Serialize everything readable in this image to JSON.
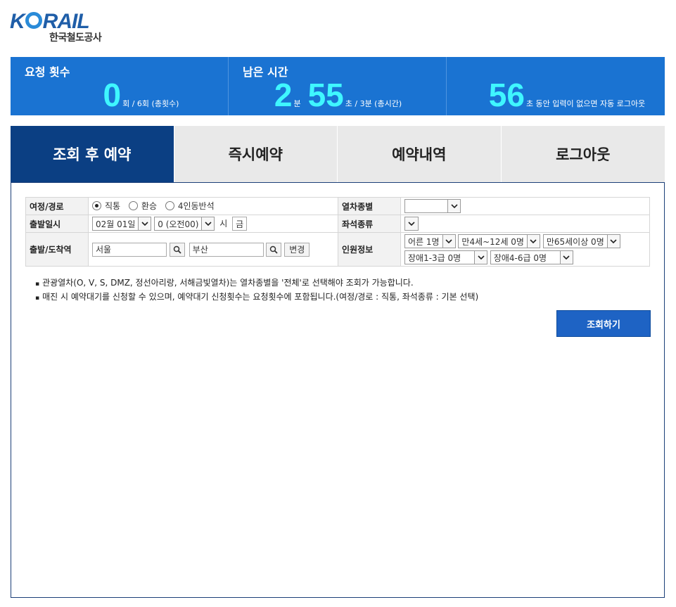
{
  "logo": {
    "word_left": "K",
    "word_right": "RAIL",
    "sub": "한국철도공사"
  },
  "status": {
    "request": {
      "title": "요청 횟수",
      "value": "0",
      "suffix": "회 / 6회 (총횟수)"
    },
    "remaining": {
      "title": "남은 시간",
      "minutes": "2",
      "min_unit": "분",
      "seconds": "55",
      "sec_suffix": "초 / 3분 (총시간)"
    },
    "idle": {
      "value": "56",
      "suffix": "초 동안 입력이 없으면 자동 로그아웃"
    }
  },
  "tabs": [
    {
      "label": "조회 후 예약",
      "active": true
    },
    {
      "label": "즉시예약",
      "active": false
    },
    {
      "label": "예약내역",
      "active": false
    },
    {
      "label": "로그아웃",
      "active": false
    }
  ],
  "form": {
    "route_label": "여정/경로",
    "route_options": [
      "직통",
      "환승",
      "4인동반석"
    ],
    "route_selected": "직통",
    "train_type_label": "열차종별",
    "train_type_value": "",
    "date_label": "출발일시",
    "date_value": "02월 01일",
    "hour_value": "0 (오전00)",
    "hour_unit": "시",
    "weekday": "금",
    "seat_label": "좌석종류",
    "seat_value": "",
    "station_label": "출발/도착역",
    "departure": "서울",
    "arrival": "부산",
    "swap_label": "변경",
    "passenger_label": "인원정보",
    "passengers": {
      "adult": "어른 1명",
      "child": "만4세~12세 0명",
      "senior": "만65세이상 0명",
      "disabled1": "장애1-3급 0명",
      "disabled2": "장애4-6급 0명"
    }
  },
  "notes": [
    "관광열차(O, V, S, DMZ, 정선아리랑, 서해금빛열차)는 열차종별을 '전체'로 선택해야 조회가 가능합니다.",
    "매진 시 예약대기를 신청할 수 있으며, 예약대기 신청횟수는 요청횟수에 포함됩니다.(여정/경로 : 직통, 좌석종류 : 기본 선택)"
  ],
  "search_button": "조회하기"
}
